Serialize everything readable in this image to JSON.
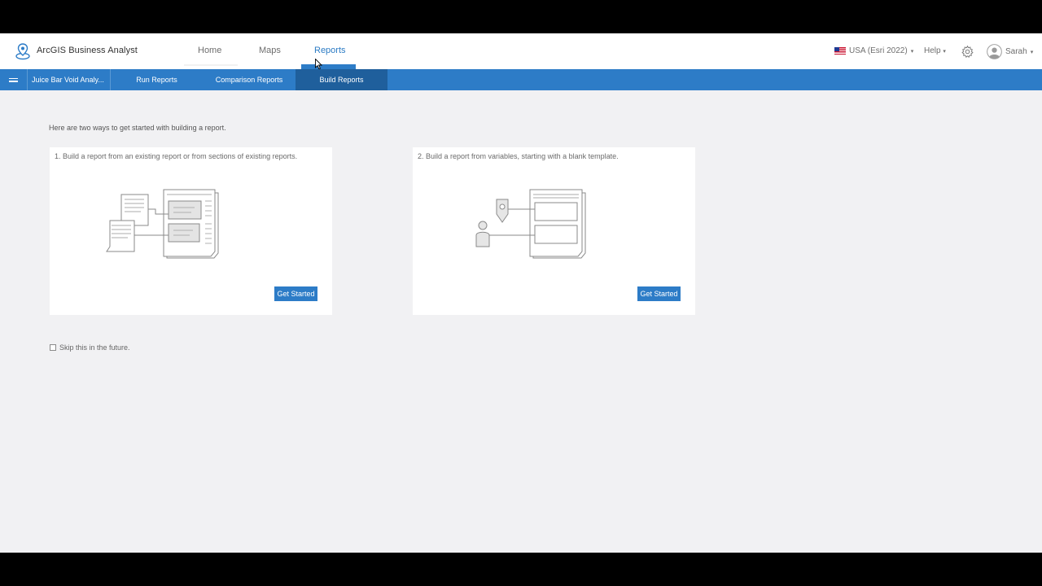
{
  "header": {
    "app_title": "ArcGIS Business Analyst",
    "nav": {
      "home": "Home",
      "maps": "Maps",
      "reports": "Reports"
    },
    "country": "USA (Esri 2022)",
    "help": "Help",
    "user_name": "Sarah",
    "caret": "▾"
  },
  "tabbar": {
    "project_name": "Juice Bar Void Analy...",
    "tabs": {
      "run": "Run Reports",
      "comparison": "Comparison Reports",
      "build": "Build Reports"
    },
    "active_tab": "Build Reports"
  },
  "main": {
    "intro": "Here are two ways to get started with building a report.",
    "cards": [
      {
        "title": "1. Build a report from an existing report or from sections of existing reports.",
        "button": "Get Started"
      },
      {
        "title": "2. Build a report from variables, starting with a blank template.",
        "button": "Get Started"
      }
    ],
    "skip_label": "Skip this in the future.",
    "skip_checked": false
  },
  "colors": {
    "accent": "#2d7cc7",
    "active_tab": "#1f5f9c",
    "background": "#f1f1f3"
  },
  "icons": [
    "location-pin-icon",
    "gear-icon",
    "user-avatar-icon",
    "us-flag-icon",
    "hamburger-menu-icon",
    "mouse-pointer-icon"
  ]
}
